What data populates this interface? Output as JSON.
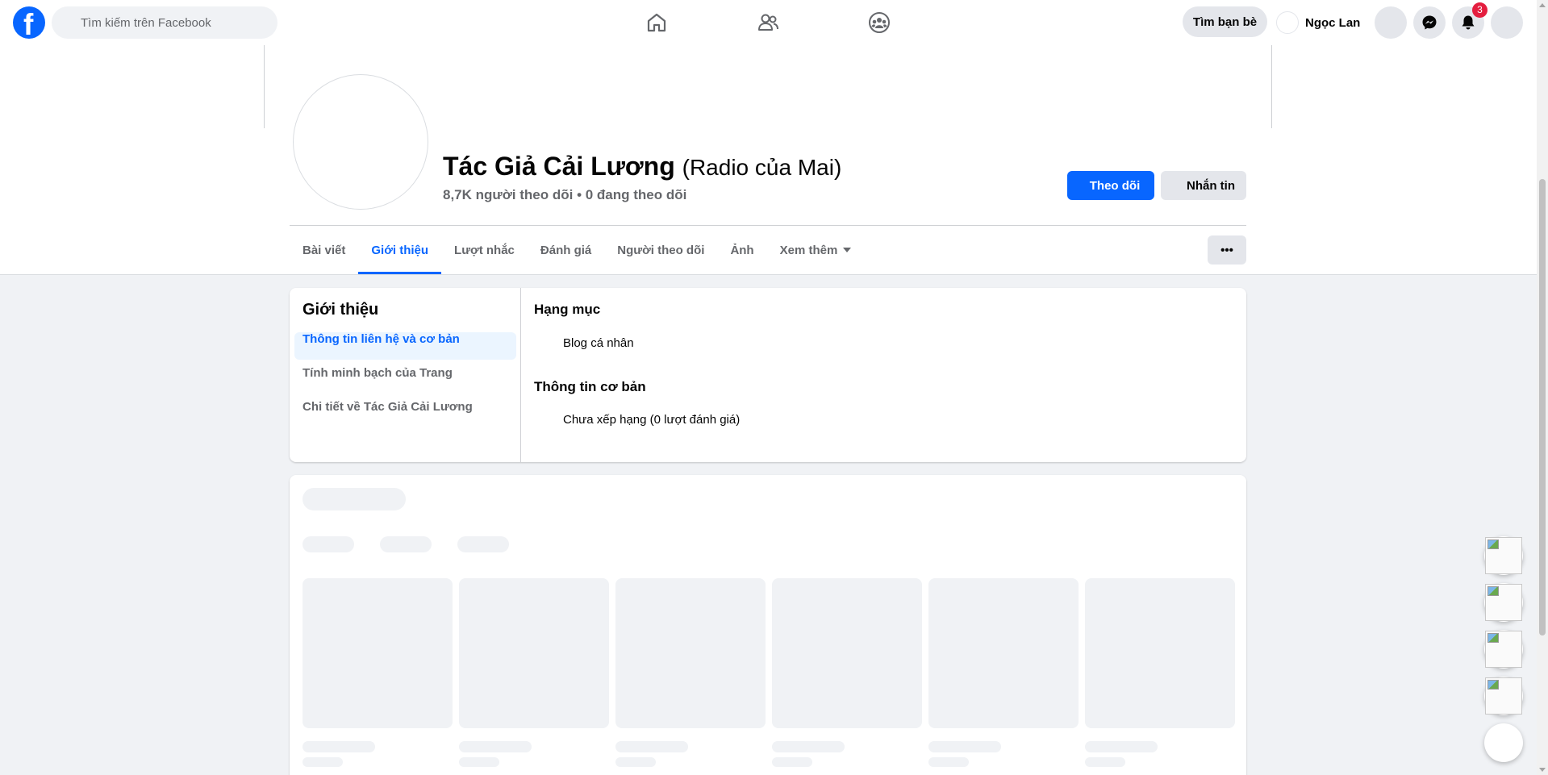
{
  "topbar": {
    "search_placeholder": "Tìm kiếm trên Facebook",
    "find_friends_label": "Tìm bạn bè",
    "user_name": "Ngọc Lan",
    "notification_count": "3"
  },
  "page": {
    "name": "Tác Giả Cải Lương",
    "alternate_name": "(Radio của Mai)",
    "stats": "8,7K người theo dõi • 0 đang theo dõi",
    "follow_label": "Theo dõi",
    "message_label": "Nhắn tin",
    "more_label": "•••"
  },
  "tabs": [
    {
      "label": "Bài viết"
    },
    {
      "label": "Giới thiệu"
    },
    {
      "label": "Lượt nhắc"
    },
    {
      "label": "Đánh giá"
    },
    {
      "label": "Người theo dõi"
    },
    {
      "label": "Ảnh"
    },
    {
      "label": "Xem thêm"
    }
  ],
  "about": {
    "title": "Giới thiệu",
    "side_items": [
      {
        "label": "Thông tin liên hệ và cơ bản"
      },
      {
        "label": "Tính minh bạch của Trang"
      },
      {
        "label": "Chi tiết về Tác Giả Cải Lương"
      }
    ],
    "sections": [
      {
        "heading": "Hạng mục",
        "value": "Blog cá nhân"
      },
      {
        "heading": "Thông tin cơ bản",
        "value": "Chưa xếp hạng (0 lượt đánh giá)"
      }
    ]
  },
  "colors": {
    "brand": "#0866ff",
    "badge": "#e41e3f",
    "background": "#f0f2f5"
  }
}
